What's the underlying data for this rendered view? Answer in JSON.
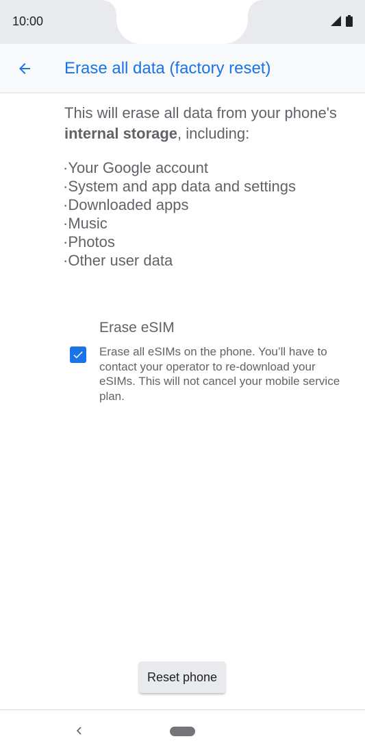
{
  "status_bar": {
    "time": "10:00",
    "icons": [
      "signal-icon",
      "battery-icon"
    ]
  },
  "app_bar": {
    "back_icon": "arrow-left-icon",
    "title": "Erase all data (factory reset)"
  },
  "intro": {
    "text_prefix": "This will erase all data from your phone's ",
    "text_bold": "internal storage",
    "text_suffix": ", including:"
  },
  "erase_items": [
    "·Your Google account",
    "·System and app data and settings",
    "·Downloaded apps",
    "·Music",
    "·Photos",
    "·Other user data"
  ],
  "esim_option": {
    "title": "Erase eSIM",
    "description": "Erase all eSIMs on the phone. You’ll have to contact your operator to re-download your eSIMs. This will not cancel your mobile service plan.",
    "checked": true
  },
  "reset_button": {
    "label": "Reset phone"
  },
  "nav_bar": {
    "back_icon": "chevron-left-icon",
    "home_icon": "home-pill-icon"
  },
  "colors": {
    "accent": "#1a73e8",
    "text_secondary": "#5f6368",
    "status_bar_bg": "#e8eaed"
  }
}
